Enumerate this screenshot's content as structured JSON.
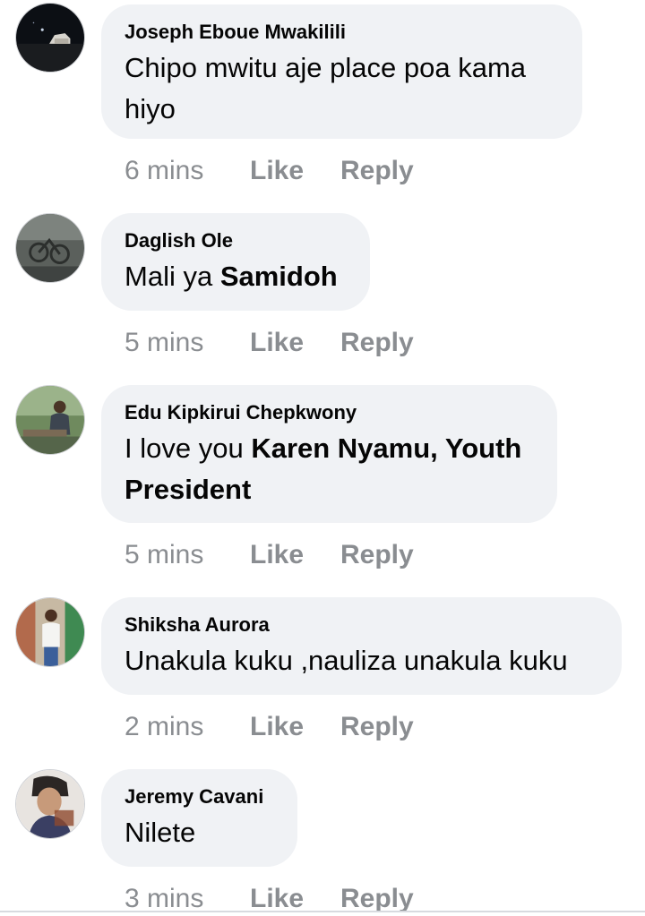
{
  "comments": [
    {
      "author": "Joseph Eboue Mwakilili",
      "text_parts": [
        "Chipo mwitu aje place poa kama hiyo"
      ],
      "time": "6 mins",
      "like_label": "Like",
      "reply_label": "Reply",
      "avatar_icon": "night-sky-avatar"
    },
    {
      "author": "Daglish Ole",
      "text_parts": [
        "Mali ya ",
        "Samidoh"
      ],
      "time": "5 mins",
      "like_label": "Like",
      "reply_label": "Reply",
      "avatar_icon": "bicycles-photo-avatar"
    },
    {
      "author": "Edu Kipkirui Chepkwony",
      "text_parts": [
        "I love you ",
        "Karen Nyamu, Youth President"
      ],
      "time": "5 mins",
      "like_label": "Like",
      "reply_label": "Reply",
      "avatar_icon": "outdoor-person-avatar"
    },
    {
      "author": "Shiksha Aurora",
      "text_parts": [
        "Unakula kuku ,nauliza unakula kuku"
      ],
      "time": "2 mins",
      "like_label": "Like",
      "reply_label": "Reply",
      "avatar_icon": "standing-person-avatar"
    },
    {
      "author": "Jeremy Cavani",
      "text_parts": [
        "Nilete"
      ],
      "time": "3 mins",
      "like_label": "Like",
      "reply_label": "Reply",
      "avatar_icon": "portrait-avatar"
    }
  ],
  "colors": {
    "bubble_bg": "#f0f2f5",
    "meta_text": "#8a8d91",
    "primary_text": "#050505"
  }
}
